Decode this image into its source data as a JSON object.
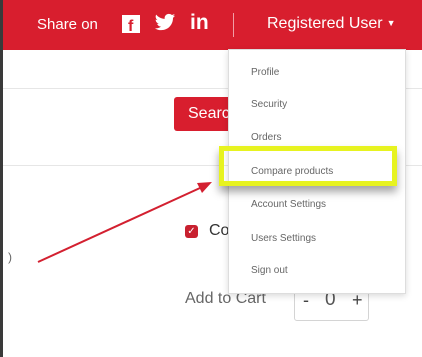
{
  "header": {
    "share_label": "Share on",
    "social_icons": [
      "facebook-icon",
      "twitter-icon",
      "linkedin-icon"
    ],
    "facebook_glyph": "f",
    "linkedin_glyph": "in",
    "user_label": "Registered User",
    "caret": "▼"
  },
  "content": {
    "search_label": "Search",
    "stray_char": ")",
    "checkbox_check": "✓",
    "compare_label_partial": "Co",
    "add_to_cart_label": "Add to Cart",
    "quantity": {
      "minus": "-",
      "value": "0",
      "plus": "+"
    }
  },
  "dropdown": {
    "items": [
      {
        "label": "Profile"
      },
      {
        "label": "Security"
      },
      {
        "label": "Orders"
      },
      {
        "label": "Compare products"
      },
      {
        "label": "Account Settings"
      },
      {
        "label": "Users Settings"
      },
      {
        "label": "Sign out"
      }
    ]
  },
  "colors": {
    "brand_red": "#d81e2e",
    "highlight_yellow": "#e7f320",
    "arrow_red": "#d32030"
  }
}
